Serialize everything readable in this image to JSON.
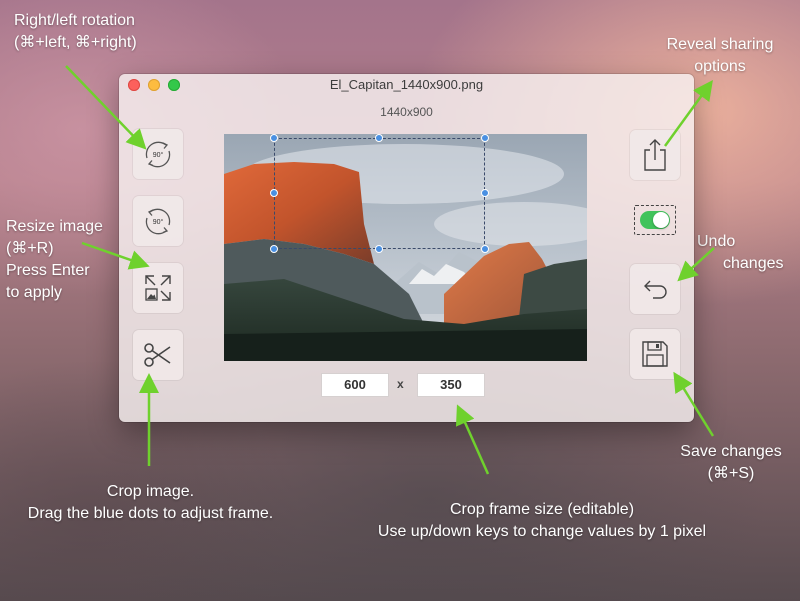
{
  "window": {
    "title": "El_Capitan_1440x900.png",
    "dimensions": "1440x900"
  },
  "toolbar_left": [
    {
      "name": "rotate-left",
      "label": "90°"
    },
    {
      "name": "rotate-right",
      "label": "90°"
    },
    {
      "name": "resize",
      "label": ""
    },
    {
      "name": "crop",
      "label": ""
    }
  ],
  "crop_size": {
    "width": "600",
    "separator": "x",
    "height": "350"
  },
  "toolbar_right": {
    "share": "share-icon",
    "toggle_on": true,
    "undo": "undo-icon",
    "save": "save-icon"
  },
  "annotations": {
    "rotation": [
      "Right/left rotation",
      "(⌘+left, ⌘+right)"
    ],
    "resize": [
      "Resize image",
      "(⌘+R)",
      "Press Enter",
      "to apply"
    ],
    "crop": [
      "Crop image.",
      "Drag the blue dots to adjust frame."
    ],
    "crop_size": [
      "Crop frame size (editable)",
      "Use up/down keys to change values by 1 pixel"
    ],
    "sharing": [
      "Reveal sharing",
      "options"
    ],
    "undo": [
      "Undo",
      "changes"
    ],
    "save": [
      "Save changes",
      "(⌘+S)"
    ]
  },
  "colors": {
    "accent_green": "#6fd12d",
    "toggle_on": "#41c35b",
    "handle_blue": "#4a90e2"
  }
}
